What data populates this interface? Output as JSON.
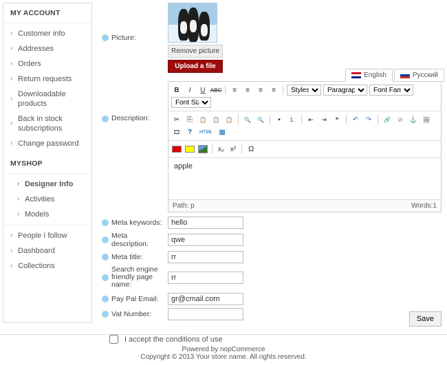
{
  "sidebar": {
    "title1": "MY ACCOUNT",
    "group1": [
      "Customer info",
      "Addresses",
      "Orders",
      "Return requests",
      "Downloadable products",
      "Back in stock subscriptions",
      "Change password"
    ],
    "title2": "MYSHOP",
    "group2": [
      "Designer Info",
      "Activities",
      "Models"
    ],
    "group3": [
      "People I follow",
      "Dashboard",
      "Collections"
    ]
  },
  "picture": {
    "label": "Picture:",
    "remove": "Remove picture",
    "upload": "Upload a file"
  },
  "tabs": {
    "en": "English",
    "ru": "Русский"
  },
  "editor": {
    "label": "Description:",
    "content": "apple",
    "path": "Path: p",
    "words": "Words:1",
    "styles": "Styles",
    "paragraph": "Paragraph",
    "fontfamily": "Font Family",
    "fontsize": "Font Size",
    "html_label": "HTML",
    "bold": "B",
    "italic": "I",
    "under": "U",
    "strike": "ABC",
    "sub": "x₂",
    "sup": "x²"
  },
  "fields": {
    "meta_keywords": {
      "label": "Meta keywords:",
      "value": "hello"
    },
    "meta_description": {
      "label": "Meta description:",
      "value": "qwe"
    },
    "meta_title": {
      "label": "Meta title:",
      "value": "rr"
    },
    "sef_name": {
      "label": "Search engine friendly page name:",
      "value": "rr"
    },
    "paypal": {
      "label": "Pay Pal Email:",
      "value": "gr@cmail.com"
    },
    "vat": {
      "label": "Vat Number:",
      "value": ""
    }
  },
  "accept": "I accept the conditions of use",
  "save": "Save",
  "footer": {
    "l1": "Powered by nopCommerce",
    "l2": "Copyright © 2013 Your store name. All rights reserved."
  }
}
